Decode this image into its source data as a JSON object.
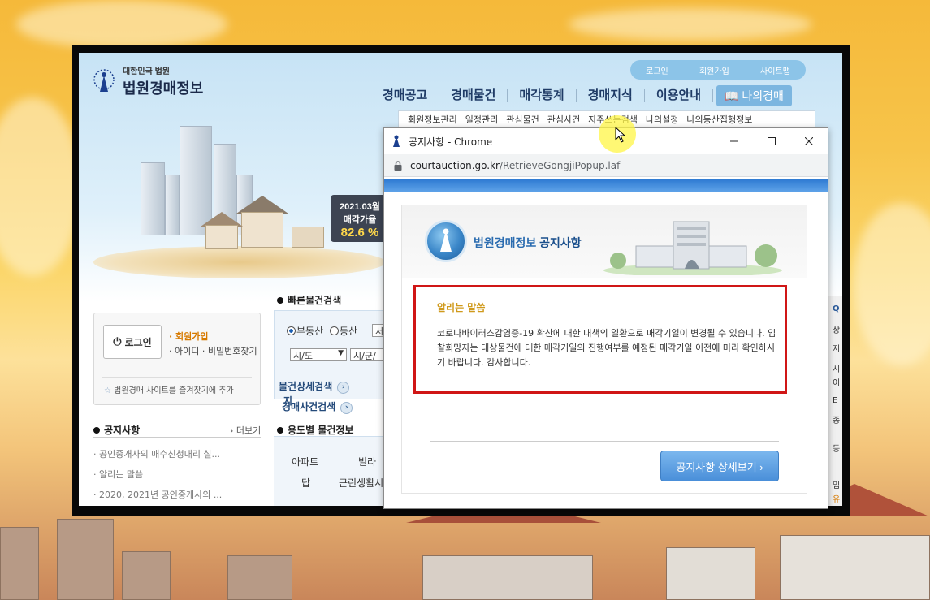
{
  "site": {
    "logo_sub": "대한민국 법원",
    "logo_main": "법원경매정보",
    "top_links": [
      "로그인",
      "회원가입",
      "사이트맵"
    ],
    "main_nav": [
      "경매공고",
      "경매물건",
      "매각통계",
      "경매지식",
      "이용안내"
    ],
    "my_auction": "나의경매",
    "sub_nav": [
      "회원정보관리",
      "일정관리",
      "관심물건",
      "관심사건",
      "자주쓰는검색",
      "나의설정",
      "나의동산집행정보"
    ],
    "billboard": {
      "date": "2021.03월",
      "text": "매각가율",
      "value": "82.6 %"
    },
    "login": {
      "button": "로그인",
      "join": "회원가입",
      "find": "아이디 · 비밀번호찾기",
      "favorite": "법원경매 사이트를 즐겨찾기에 추가"
    },
    "notice": {
      "title": "공지사항",
      "more": "› 더보기",
      "items": [
        "공인중개사의 매수신청대리 실...",
        "알리는 말씀",
        "2020, 2021년 공인중개사의 ..."
      ]
    },
    "quick_search": {
      "title": "빠른물건검색",
      "radio_realestate": "부동산",
      "radio_movable": "동산",
      "sido": "시/도",
      "sigungu": "시/군/",
      "region_input": "서",
      "detail": "물건상세검색",
      "case": "경매사건검색",
      "case_suffix": "지"
    },
    "usage": {
      "title": "용도별 물건정보",
      "items": [
        "아파트",
        "빌라",
        "답",
        "근린생활시"
      ]
    },
    "side_panel": [
      "Q",
      "상",
      "지",
      "시",
      "이",
      "E",
      "종",
      "등",
      "입",
      "유"
    ]
  },
  "popup": {
    "window_title": "공지사항 - Chrome",
    "url_host": "courtauction.go.kr",
    "url_path": "/RetrieveGongjiPopup.laf",
    "header_prefix": "법원경매정보 ",
    "header_title": "공지사항",
    "notice_title": "알리는 말씀",
    "notice_body": "코로나바이러스감염증-19 확산에 대한 대책의 일환으로 매각기일이 변경될 수 있습니다. 입찰희망자는 대상물건에 대한 매각기일의 진행여부를 예정된 매각기일 이전에 미리 확인하시기 바랍니다. 감사합니다.",
    "detail_button": "공지사항 상세보기 ›"
  },
  "colors": {
    "accent_blue": "#4a8fd9",
    "highlight_red": "#d01616",
    "notice_gold": "#d09a1c",
    "join_orange": "#d77a00"
  },
  "icons": [
    "gavel-logo-icon",
    "power-icon",
    "star-icon",
    "chrome-app-icon",
    "minimize-icon",
    "maximize-icon",
    "close-icon",
    "lock-icon",
    "court-emblem-icon",
    "mouse-cursor-icon"
  ]
}
